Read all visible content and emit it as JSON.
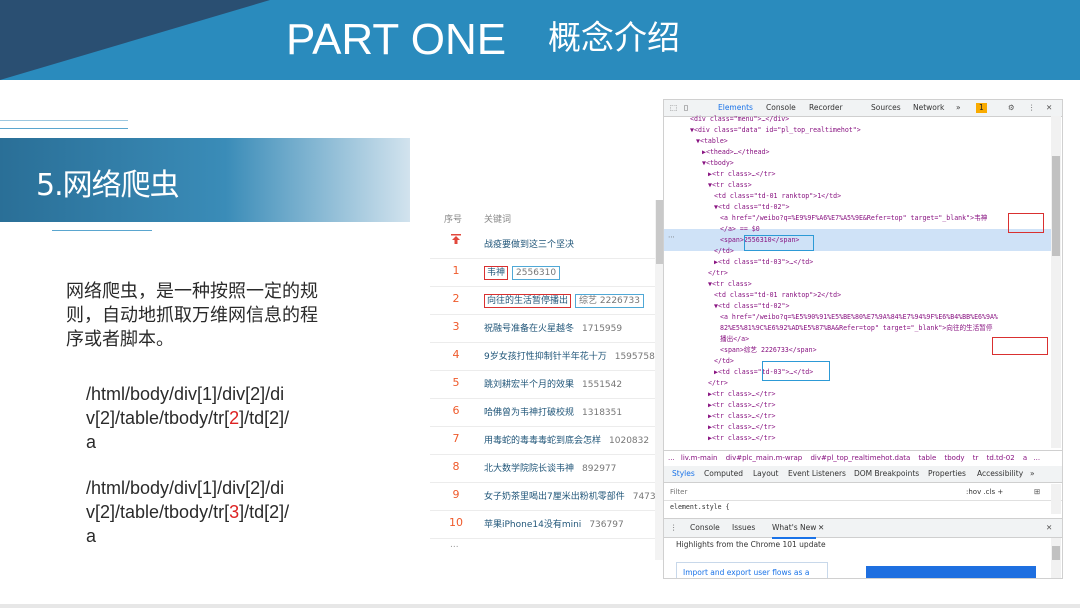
{
  "header": {
    "title": "PART ONE",
    "subtitle": "概念介绍"
  },
  "section": {
    "title": "5.网络爬虫"
  },
  "description": [
    "网络爬虫，是一种按照一定的规",
    "则，自动地抓取万维网信息的程",
    "序或者脚本。"
  ],
  "xpaths": [
    {
      "lines": [
        "/html/body/div[1]/div[2]/di",
        "v[2]/table/tbody/tr[",
        "2",
        "]/td[2]/",
        "a"
      ]
    },
    {
      "lines": [
        "/html/body/div[1]/div[2]/di",
        "v[2]/table/tbody/tr[",
        "3",
        "]/td[2]/",
        "a"
      ]
    }
  ],
  "hot_list": {
    "header_rank": "序号",
    "header_keyword": "关键词",
    "pinned": "战疫要做到这三个坚决",
    "rows": [
      {
        "rank": "1",
        "keyword": "韦神",
        "count": "2556310"
      },
      {
        "rank": "2",
        "keyword": "向往的生活暂停播出",
        "count": "综艺 2226733"
      },
      {
        "rank": "3",
        "keyword": "祝融号准备在火星越冬",
        "count": "1715959"
      },
      {
        "rank": "4",
        "keyword": "9岁女孩打性抑制针半年花十万",
        "count": "1595758"
      },
      {
        "rank": "5",
        "keyword": "跳刘耕宏半个月的效果",
        "count": "1551542"
      },
      {
        "rank": "6",
        "keyword": "哈佛曾为韦神打破校规",
        "count": "1318351"
      },
      {
        "rank": "7",
        "keyword": "用毒蛇的毒毒毒蛇到底会怎样",
        "count": "1020832"
      },
      {
        "rank": "8",
        "keyword": "北大数学院院长谈韦神",
        "count": "892977"
      },
      {
        "rank": "9",
        "keyword": "女子奶茶里喝出7厘米出粉机零部件",
        "count": "7473"
      },
      {
        "rank": "10",
        "keyword": "苹果iPhone14没有mini",
        "count": "736797"
      }
    ],
    "more": "..."
  },
  "devtools": {
    "tabs": [
      "Elements",
      "Console",
      "Recorder",
      "Sources",
      "Network",
      "»"
    ],
    "badge": "1",
    "code": [
      {
        "i": 4,
        "t": "<div class=\"menu\">…</div>"
      },
      {
        "i": 4,
        "t": "▼<div class=\"data\" id=\"pl_top_realtimehot\">"
      },
      {
        "i": 5,
        "t": "▼<table>"
      },
      {
        "i": 6,
        "t": "▶<thead>…</thead>"
      },
      {
        "i": 6,
        "t": "▼<tbody>"
      },
      {
        "i": 7,
        "t": "▶<tr class>…</tr>"
      },
      {
        "i": 7,
        "t": "▼<tr class>"
      },
      {
        "i": 8,
        "t": "<td class=\"td-01 ranktop\">1</td>"
      },
      {
        "i": 8,
        "t": "▼<td class=\"td-02\">"
      },
      {
        "i": 9,
        "t": "<a href=\"/weibo?q=%E9%9F%A6%E7%A5%9E&Refer=top\" target=\"_blank\">韦神"
      },
      {
        "i": 9,
        "t": "</a> == $0"
      },
      {
        "i": 9,
        "t": "<span>2556310</span>"
      },
      {
        "i": 8,
        "t": "</td>"
      },
      {
        "i": 8,
        "t": "▶<td class=\"td-03\">…</td>"
      },
      {
        "i": 7,
        "t": "</tr>"
      },
      {
        "i": 7,
        "t": "▼<tr class>"
      },
      {
        "i": 8,
        "t": "<td class=\"td-01 ranktop\">2</td>"
      },
      {
        "i": 8,
        "t": "▼<td class=\"td-02\">"
      },
      {
        "i": 9,
        "t": "<a href=\"/weibo?q=%E5%90%91%E5%BE%80%E7%9A%84%E7%94%9F%E6%B4%BB%E6%9A%"
      },
      {
        "i": 9,
        "t": "82%E5%81%9C%E6%92%AD%E5%87%BA&Refer=top\" target=\"_blank\">向往的生活暂停"
      },
      {
        "i": 9,
        "t": "播出</a>"
      },
      {
        "i": 9,
        "t": "<span>综艺 2226733</span>"
      },
      {
        "i": 8,
        "t": "</td>"
      },
      {
        "i": 8,
        "t": "▶<td class=\"td-03\">…</td>"
      },
      {
        "i": 7,
        "t": "</tr>"
      },
      {
        "i": 7,
        "t": "▶<tr class>…</tr>"
      },
      {
        "i": 7,
        "t": "▶<tr class>…</tr>"
      },
      {
        "i": 7,
        "t": "▶<tr class>…</tr>"
      },
      {
        "i": 7,
        "t": "▶<tr class>…</tr>"
      },
      {
        "i": 7,
        "t": "▶<tr class>…</tr>"
      }
    ],
    "breadcrumb": [
      "...",
      "liv.m-main",
      "div#plc_main.m-wrap",
      "div#pl_top_realtimehot.data",
      "table",
      "tbody",
      "tr",
      "td.td-02",
      "a",
      "..."
    ],
    "style_tabs": [
      "Styles",
      "Computed",
      "Layout",
      "Event Listeners",
      "DOM Breakpoints",
      "Properties",
      "Accessibility",
      "»"
    ],
    "filter_placeholder": "Filter",
    "filter_right": ":hov  .cls  +",
    "style_rule": "element.style {",
    "drawer_tabs": [
      "Console",
      "Issues",
      "What's New"
    ],
    "whats_new_title": "Highlights from the Chrome 101 update",
    "whats_new_link": "Import and export user flows as a"
  }
}
